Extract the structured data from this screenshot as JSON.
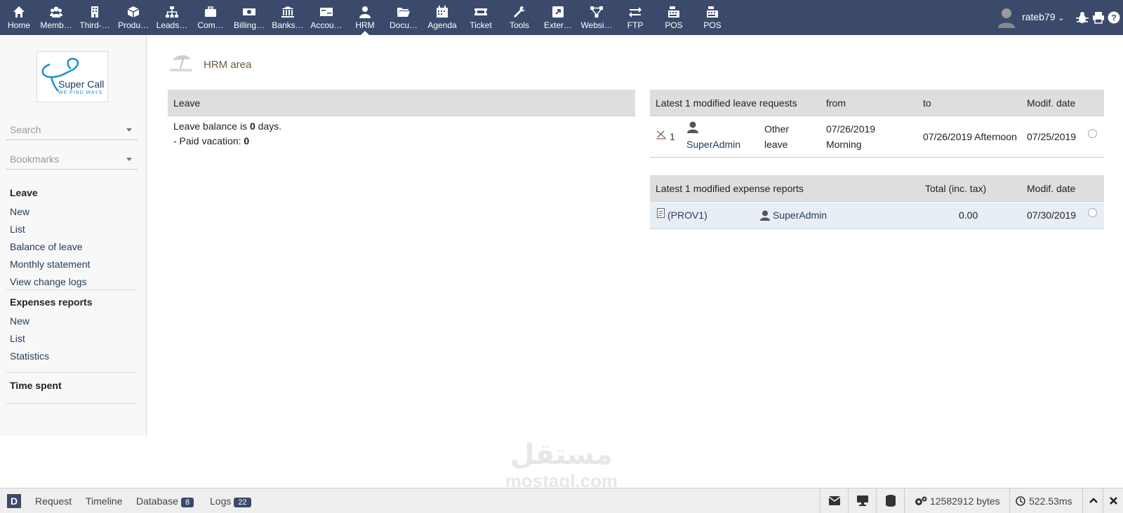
{
  "menu": [
    {
      "label": "Home",
      "icon": "home-icon"
    },
    {
      "label": "Memb…",
      "icon": "users-icon"
    },
    {
      "label": "Third-…",
      "icon": "building-icon"
    },
    {
      "label": "Produ…",
      "icon": "cube-icon"
    },
    {
      "label": "Leads…",
      "icon": "sitemap-icon"
    },
    {
      "label": "Com…",
      "icon": "briefcase-icon"
    },
    {
      "label": "Billing…",
      "icon": "money-bill-icon"
    },
    {
      "label": "Banks…",
      "icon": "bank-icon"
    },
    {
      "label": "Accou…",
      "icon": "money-check-icon"
    },
    {
      "label": "HRM",
      "icon": "user-tie-icon",
      "active": true
    },
    {
      "label": "Docu…",
      "icon": "folder-open-icon"
    },
    {
      "label": "Agenda",
      "icon": "calendar-icon"
    },
    {
      "label": "Ticket",
      "icon": "ticket-icon"
    },
    {
      "label": "Tools",
      "icon": "wrench-icon"
    },
    {
      "label": "Exter…",
      "icon": "external-link-icon"
    },
    {
      "label": "Websi…",
      "icon": "network-icon"
    },
    {
      "label": "FTP",
      "icon": "exchange-icon"
    },
    {
      "label": "POS",
      "icon": "cash-register-icon"
    },
    {
      "label": "POS",
      "icon": "cash-register-icon"
    }
  ],
  "user": {
    "name": "rateb79"
  },
  "sidebar": {
    "logo_text": "Super Call",
    "logo_tagline": "WE FIND WAYS",
    "search_placeholder": "Search",
    "bookmarks_placeholder": "Bookmarks",
    "leave": {
      "title": "Leave",
      "links": [
        "New",
        "List",
        "Balance of leave",
        "Monthly statement",
        "View change logs"
      ]
    },
    "expenses": {
      "title": "Expenses reports",
      "links": [
        "New",
        "List",
        "Statistics"
      ]
    },
    "time": {
      "title": "Time spent"
    }
  },
  "page": {
    "title": "HRM area"
  },
  "leave_panel": {
    "header": "Leave",
    "balance_prefix": "Leave balance is ",
    "balance_value": "0",
    "balance_suffix": " days.",
    "paid_prefix": "- Paid vacation: ",
    "paid_value": "0"
  },
  "leave_requests": {
    "headers": [
      "Latest 1 modified leave requests",
      "from",
      "to",
      "Modif. date"
    ],
    "row": {
      "ref": "1",
      "user": "SuperAdmin",
      "type_line1": "Other",
      "type_line2": "leave",
      "from_line1": "07/26/2019",
      "from_line2": "Morning",
      "to": "07/26/2019 Afternoon",
      "modif": "07/25/2019"
    }
  },
  "expense_reports": {
    "headers": [
      "Latest 1 modified expense reports",
      "Total (inc. tax)",
      "Modif. date"
    ],
    "row": {
      "ref": "(PROV1)",
      "user": "SuperAdmin",
      "total": "0.00",
      "modif": "07/30/2019"
    }
  },
  "debugbar": {
    "logo": "D",
    "request": "Request",
    "timeline": "Timeline",
    "database": "Database",
    "database_count": "8",
    "logs": "Logs",
    "logs_count": "22",
    "memory": "12582912 bytes",
    "time": "522.53ms"
  },
  "watermark": {
    "arabic": "مستقل",
    "latin": "mostaql.com"
  },
  "colors": {
    "topbar": "#3b4a6b",
    "panel_header": "#dedede",
    "link": "#263c5c",
    "page_title": "#6b5a3a"
  }
}
